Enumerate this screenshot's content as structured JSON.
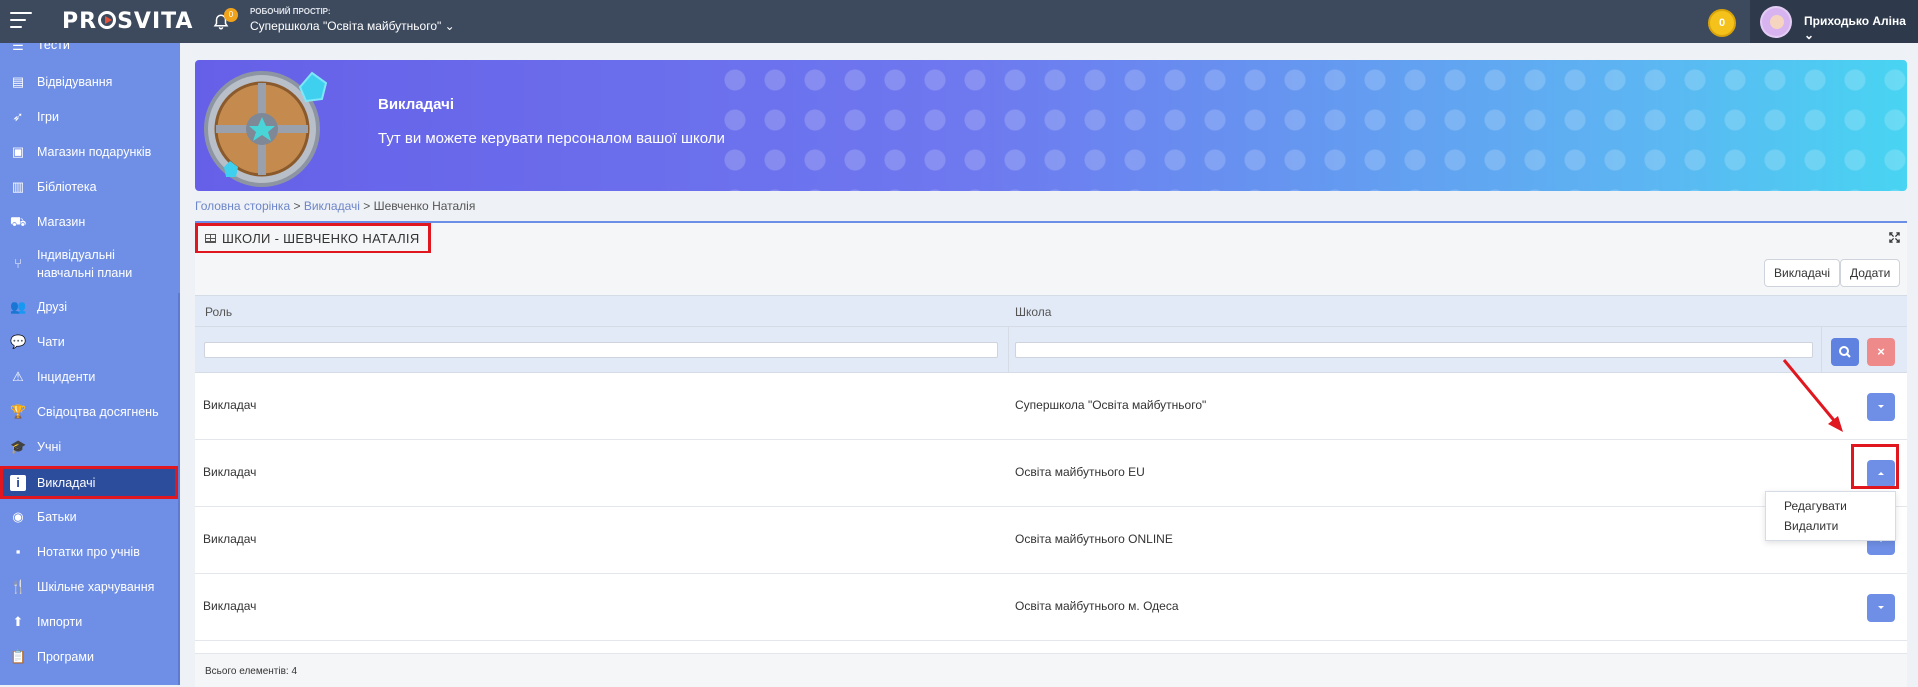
{
  "header": {
    "logo": "PROSVITA",
    "bell_count": "0",
    "workspace_label": "РОБОЧИЙ ПРОСТІР:",
    "workspace_name": "Супершкола \"Освіта майбутнього\"",
    "coins": "0",
    "user_name": "Приходько Аліна"
  },
  "sidebar": {
    "items": [
      {
        "label": "Тести",
        "icon": "tests-icon"
      },
      {
        "label": "Відвідування",
        "icon": "attendance-icon"
      },
      {
        "label": "Ігри",
        "icon": "rocket-icon"
      },
      {
        "label": "Магазин подарунків",
        "icon": "gift-icon"
      },
      {
        "label": "Бібліотека",
        "icon": "book-icon"
      },
      {
        "label": "Магазин",
        "icon": "cart-icon"
      },
      {
        "label": "Індивідуальні",
        "label2": "навчальні плани",
        "icon": "branch-icon"
      },
      {
        "label": "Друзі",
        "icon": "users-icon"
      },
      {
        "label": "Чати",
        "icon": "chat-icon"
      },
      {
        "label": "Інциденти",
        "icon": "warning-icon"
      },
      {
        "label": "Свідоцтва досягнень",
        "icon": "trophy-icon"
      },
      {
        "label": "Учні",
        "icon": "graduation-cap-icon"
      },
      {
        "label": "Викладачі",
        "icon": "teacher-icon",
        "active": true
      },
      {
        "label": "Батьки",
        "icon": "parent-icon"
      },
      {
        "label": "Нотатки про учнів",
        "icon": "note-icon"
      },
      {
        "label": "Шкільне харчування",
        "icon": "cutlery-icon"
      },
      {
        "label": "Імпорти",
        "icon": "upload-icon"
      },
      {
        "label": "Програми",
        "icon": "clipboard-icon"
      }
    ]
  },
  "banner": {
    "title": "Викладачі",
    "subtitle": "Тут ви можете керувати персоналом вашої школи"
  },
  "breadcrumb": {
    "home": "Головна сторінка",
    "sep": " > ",
    "teachers": "Викладачі",
    "current": "Шевченко Наталія"
  },
  "panel": {
    "title": "ШКОЛИ - ШЕВЧЕНКО НАТАЛІЯ",
    "buttons": {
      "teachers": "Викладачі",
      "add": "Додати"
    },
    "columns": {
      "role": "Роль",
      "school": "Школа"
    },
    "filters": {
      "role": "",
      "school": ""
    },
    "rows": [
      {
        "role": "Викладач",
        "school": "Супершкола \"Освіта майбутнього\""
      },
      {
        "role": "Викладач",
        "school": "Освіта майбутнього EU"
      },
      {
        "role": "Викладач",
        "school": "Освіта майбутнього ONLINE"
      },
      {
        "role": "Викладач",
        "school": "Освіта майбутнього м. Одеса"
      }
    ],
    "dropdown": {
      "edit": "Редагувати",
      "delete": "Видалити"
    },
    "footer": "Всього елементів: 4"
  },
  "colors": {
    "topbar": "#3d4a5e",
    "sidebar": "#6f8fe6",
    "sidebar_active": "#2c4c9c",
    "accent_button": "#6f8fe6",
    "highlight": "#e0171f"
  }
}
